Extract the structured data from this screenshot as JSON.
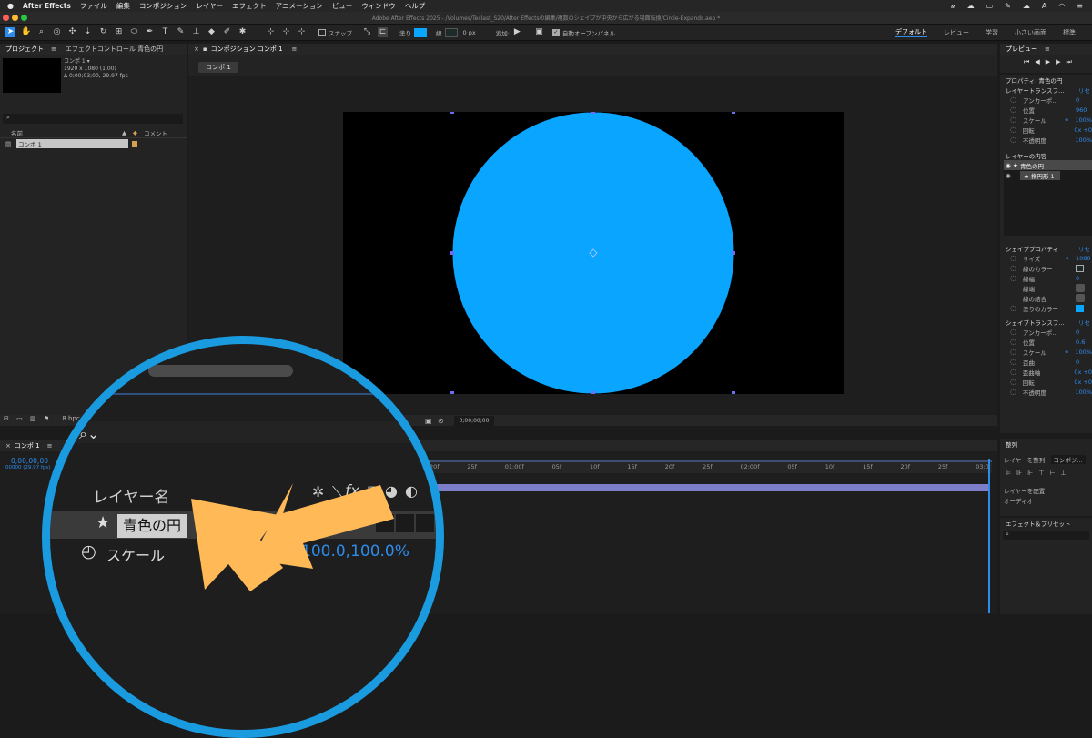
{
  "menubar": {
    "items": [
      "After Effects",
      "ファイル",
      "編集",
      "コンポジション",
      "レイヤー",
      "エフェクト",
      "アニメーション",
      "ビュー",
      "ウィンドウ",
      "ヘルプ"
    ]
  },
  "titlebar": {
    "title": "Adobe After Effects 2025 - /Volumes/Teclast_S20/After Effectsの編集/複数のシェイプが中央から広がる場面転換/Circle-Expands.aep *"
  },
  "toolbar": {
    "snap_label": "スナップ",
    "fill_label": "塗り",
    "stroke_label": "線",
    "stroke_value": "0 px",
    "add_label": "追加:",
    "auto_open_label": "自動オープンパネル"
  },
  "workspaces": [
    "デフォルト",
    "レビュー",
    "学習",
    "小さい画面",
    "標準"
  ],
  "project": {
    "tab": "プロジェクト",
    "effect_tab": "エフェクトコントロール 青色の円",
    "comp_name": "コンポ 1 ▾",
    "comp_size": "1920 x 1080 (1.00)",
    "comp_duration": "Δ 0;00;03;00, 29.97 fps",
    "col_name": "名前",
    "col_comment": "コメント",
    "item": "コンポ 1"
  },
  "comp_panel": {
    "tab": "コンポジション コンポ 1",
    "sub_tab": "コンポ 1",
    "timecode": "0;00;00;00",
    "bpc": "8 bpc"
  },
  "timeline": {
    "tab": "コンポ 1",
    "timecode": "0;00;00;00",
    "timecode_sub": "00000 (29.97 fps)",
    "ruler": [
      "20f",
      "25f",
      "01:00f",
      "05f",
      "10f",
      "15f",
      "20f",
      "25f",
      "02:00f",
      "05f",
      "10f",
      "15f",
      "20f",
      "25f",
      "03:0"
    ]
  },
  "zoom": {
    "layer_name_header": "レイヤー名",
    "layer_name": "青色の円",
    "prop_label": "スケール",
    "scale_value": "100.0,100.0%"
  },
  "right": {
    "preview_tab": "プレビュー",
    "properties_title": "プロパティ: 青色の円",
    "layer_transform": "レイヤートランスフ...",
    "reset": "リセ",
    "lt_rows": [
      {
        "label": "アンカーポ...",
        "value": "0"
      },
      {
        "label": "位置",
        "value": "960"
      },
      {
        "label": "スケール",
        "value": "100%"
      },
      {
        "label": "回転",
        "value": "0x +0"
      },
      {
        "label": "不透明度",
        "value": "100%"
      }
    ],
    "layer_contents": "レイヤーの内容",
    "contents_items": [
      "青色の円",
      "楕円形 1"
    ],
    "shape_props": "シェイププロパティ",
    "sp_rows": [
      {
        "label": "サイズ",
        "value": "1080"
      },
      {
        "label": "線のカラー",
        "value": ""
      },
      {
        "label": "線幅",
        "value": "0"
      },
      {
        "label": "線端",
        "value": ""
      },
      {
        "label": "線の結合",
        "value": ""
      },
      {
        "label": "塗りのカラー",
        "value": ""
      }
    ],
    "shape_transform": "シェイプトランスフ...",
    "st_rows": [
      {
        "label": "アンカーポ...",
        "value": "0"
      },
      {
        "label": "位置",
        "value": "0.6"
      },
      {
        "label": "スケール",
        "value": "100%"
      },
      {
        "label": "歪曲",
        "value": "0"
      },
      {
        "label": "歪曲軸",
        "value": "0x +0"
      },
      {
        "label": "回転",
        "value": "0x +0"
      },
      {
        "label": "不透明度",
        "value": "100%"
      }
    ],
    "align_title": "整列",
    "align_to_label": "レイヤーを整列:",
    "align_to_value": "コンポジ...",
    "distribute_label": "レイヤーを配置:",
    "audio_tab": "オーディオ",
    "effects_tab": "エフェクト＆プリセット"
  },
  "colors": {
    "accent": "#2d8ceb",
    "circle": "#0aa5ff",
    "ring": "#1a9be0",
    "arrow": "#ffb956"
  }
}
